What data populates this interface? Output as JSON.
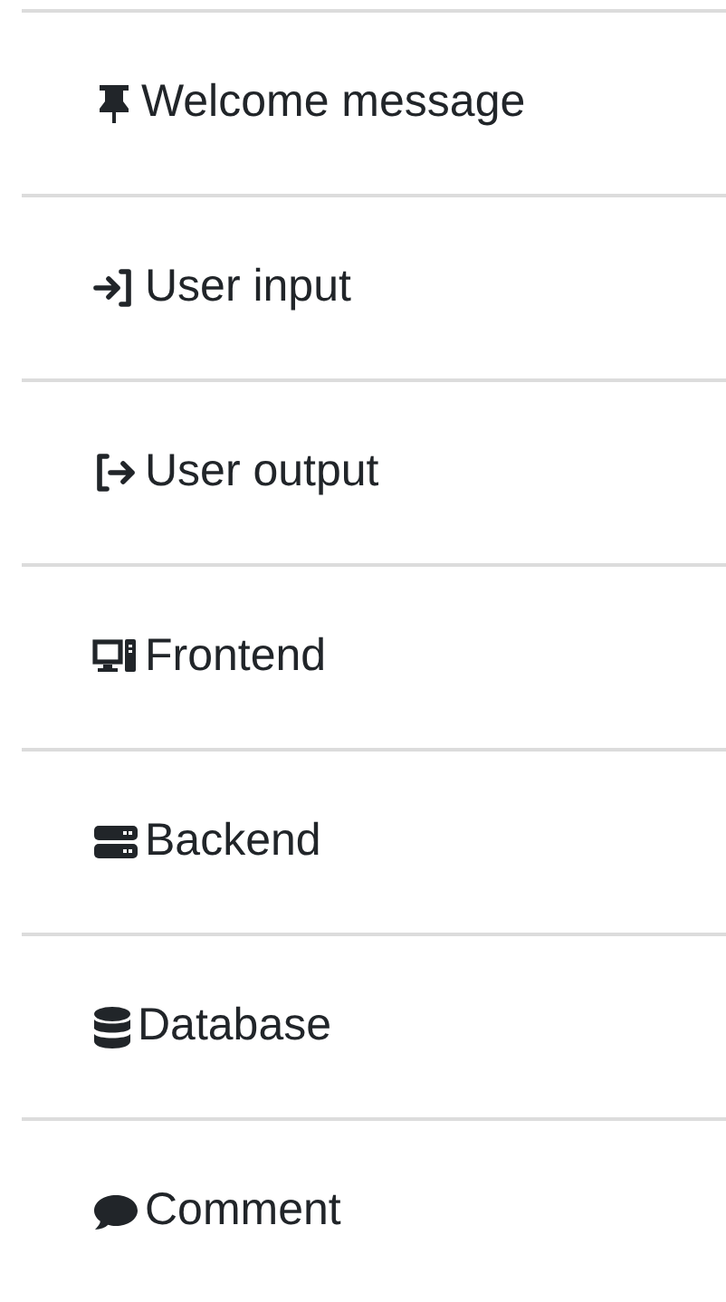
{
  "items": [
    {
      "kind": "pin",
      "label": "Welcome message"
    },
    {
      "kind": "input",
      "label": "User input"
    },
    {
      "kind": "output",
      "label": "User output"
    },
    {
      "kind": "desktop",
      "label": "Frontend"
    },
    {
      "kind": "server",
      "label": "Backend"
    },
    {
      "kind": "database",
      "label": "Database"
    },
    {
      "kind": "comment",
      "label": "Comment"
    }
  ]
}
